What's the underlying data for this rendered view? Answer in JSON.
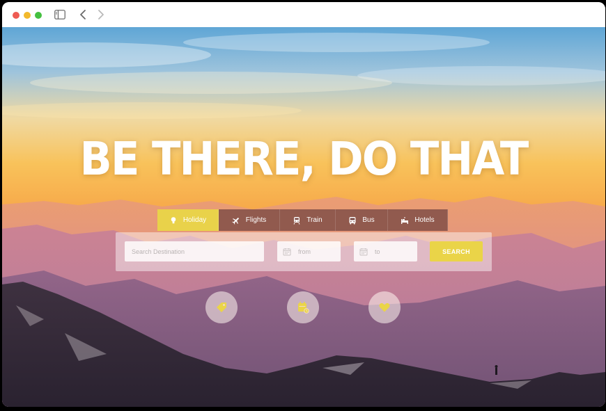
{
  "hero": {
    "title": "BE THERE, DO THAT"
  },
  "tabs": [
    {
      "label": "Holiday",
      "icon": "lightbulb-icon",
      "active": true
    },
    {
      "label": "Flights",
      "icon": "airplane-icon",
      "active": false
    },
    {
      "label": "Train",
      "icon": "train-icon",
      "active": false
    },
    {
      "label": "Bus",
      "icon": "bus-icon",
      "active": false
    },
    {
      "label": "Hotels",
      "icon": "hotel-bed-icon",
      "active": false
    }
  ],
  "search": {
    "destination_placeholder": "Search Destination",
    "from_placeholder": "from",
    "to_placeholder": "to",
    "button_label": "SEARCH"
  },
  "quick_actions": [
    {
      "icon": "tag-icon"
    },
    {
      "icon": "calendar-icon"
    },
    {
      "icon": "heart-icon"
    }
  ],
  "colors": {
    "accent": "#EAD448",
    "tab_bg": "#784842"
  }
}
